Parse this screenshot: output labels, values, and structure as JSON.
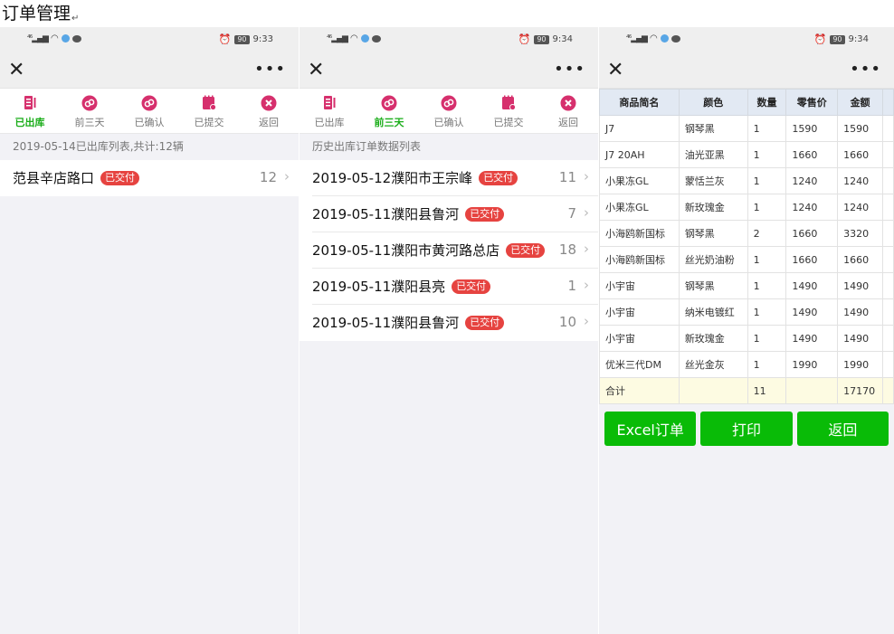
{
  "doc_title": "订单管理",
  "doc_title_mark": "↵",
  "colors": {
    "accent": "#1aad19",
    "badge": "#e64340",
    "button": "#09bb07",
    "icon": "#d6306d"
  },
  "phones": [
    {
      "time": "9:33",
      "battery": "90",
      "tabs": [
        {
          "label": "已出库",
          "icon": "document-icon",
          "active": true
        },
        {
          "label": "前三天",
          "icon": "circle-link-icon",
          "active": false
        },
        {
          "label": "已确认",
          "icon": "circle-link-icon",
          "active": false
        },
        {
          "label": "已提交",
          "icon": "calendar-check-icon",
          "active": false
        },
        {
          "label": "返回",
          "icon": "close-circle-icon",
          "active": false
        }
      ],
      "section_header": "2019-05-14已出库列表,共计:12辆",
      "rows": [
        {
          "title": "范县辛店路口",
          "badge": "已交付",
          "count": "12"
        }
      ]
    },
    {
      "time": "9:34",
      "battery": "90",
      "tabs": [
        {
          "label": "已出库",
          "icon": "document-icon",
          "active": false
        },
        {
          "label": "前三天",
          "icon": "circle-link-icon",
          "active": true
        },
        {
          "label": "已确认",
          "icon": "circle-link-icon",
          "active": false
        },
        {
          "label": "已提交",
          "icon": "calendar-check-icon",
          "active": false
        },
        {
          "label": "返回",
          "icon": "close-circle-icon",
          "active": false
        }
      ],
      "section_header": "历史出库订单数据列表",
      "rows": [
        {
          "title": "2019-05-12濮阳市王宗峰",
          "badge": "已交付",
          "count": "11"
        },
        {
          "title": "2019-05-11濮阳县鲁河",
          "badge": "已交付",
          "count": "7"
        },
        {
          "title": "2019-05-11濮阳市黄河路总店",
          "badge": "已交付",
          "count": "18"
        },
        {
          "title": "2019-05-11濮阳县亮",
          "badge": "已交付",
          "count": "1"
        },
        {
          "title": "2019-05-11濮阳县鲁河",
          "badge": "已交付",
          "count": "10"
        }
      ]
    },
    {
      "time": "9:34",
      "battery": "90",
      "table": {
        "headers": [
          "商品简名",
          "颜色",
          "数量",
          "零售价",
          "金额"
        ],
        "rows": [
          [
            "J7",
            "钢琴黑",
            "1",
            "1590",
            "1590"
          ],
          [
            "J7 20AH",
            "油光亚黑",
            "1",
            "1660",
            "1660"
          ],
          [
            "小果冻GL",
            "蒙恬兰灰",
            "1",
            "1240",
            "1240"
          ],
          [
            "小果冻GL",
            "新玫瑰金",
            "1",
            "1240",
            "1240"
          ],
          [
            "小海鸥新国标",
            "钢琴黑",
            "2",
            "1660",
            "3320"
          ],
          [
            "小海鸥新国标",
            "丝光奶油粉",
            "1",
            "1660",
            "1660"
          ],
          [
            "小宇宙",
            "钢琴黑",
            "1",
            "1490",
            "1490"
          ],
          [
            "小宇宙",
            "纳米电镀红",
            "1",
            "1490",
            "1490"
          ],
          [
            "小宇宙",
            "新玫瑰金",
            "1",
            "1490",
            "1490"
          ],
          [
            "优米三代DM",
            "丝光金灰",
            "1",
            "1990",
            "1990"
          ]
        ],
        "total": [
          "合计",
          "",
          "11",
          "",
          "17170"
        ]
      },
      "buttons": {
        "excel": "Excel订单",
        "print": "打印",
        "back": "返回"
      }
    }
  ]
}
